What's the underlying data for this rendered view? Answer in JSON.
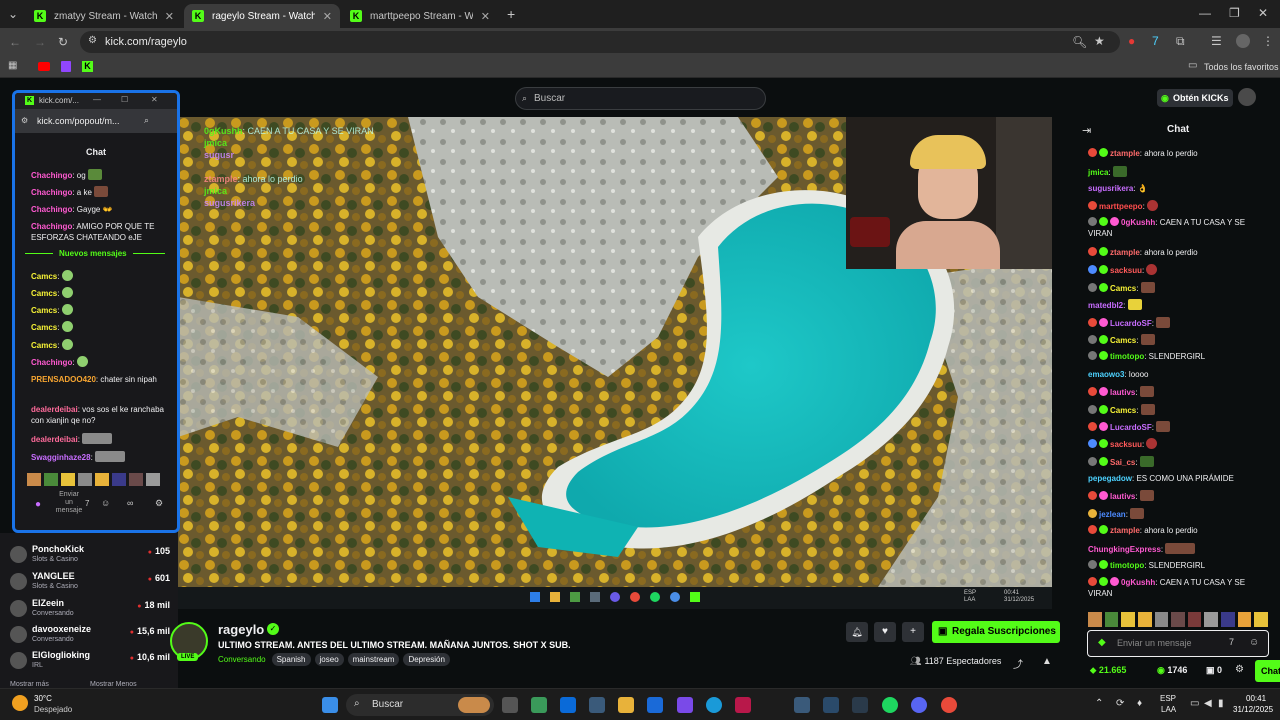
{
  "browser": {
    "tabs": [
      {
        "title": "zmatyy Stream - Watch Live o"
      },
      {
        "title": "rageylo Stream - Watch Liv"
      },
      {
        "title": "marttpeepo Stream - Watch Li"
      }
    ],
    "url": "kick.com/rageylo",
    "all_bookmarks": "Todos los favoritos"
  },
  "header": {
    "search_placeholder": "Buscar",
    "kicks_button": "Obtén KICKs"
  },
  "popup": {
    "window_title": "kick.com/...",
    "url": "kick.com/popout/m...",
    "heading": "Chat",
    "new_messages": "Nuevos mensajes",
    "input_placeholder": "Enviar un mensaje",
    "messages": [
      {
        "user": "Chachingo",
        "color": "#ff5ad1",
        "text": "og"
      },
      {
        "user": "Chachingo",
        "color": "#ff5ad1",
        "text": "a ke"
      },
      {
        "user": "Chachingo",
        "color": "#ff5ad1",
        "text": "Gayge"
      },
      {
        "user": "Chachingo",
        "color": "#ff5ad1",
        "text": "AMIGO POR QUE TE ESFORZAS CHATEANDO eJE"
      }
    ],
    "messages2": [
      {
        "user": "Camcs",
        "color": "#f6f236",
        "text": ""
      },
      {
        "user": "Camcs",
        "color": "#f6f236",
        "text": ""
      },
      {
        "user": "Camcs",
        "color": "#f6f236",
        "text": ""
      },
      {
        "user": "Camcs",
        "color": "#f6f236",
        "text": ""
      },
      {
        "user": "Camcs",
        "color": "#f6f236",
        "text": ""
      },
      {
        "user": "Chachingo",
        "color": "#ff5ad1",
        "text": ""
      },
      {
        "user": "PRENSADOO420",
        "color": "#f7a531",
        "text": "chater sin nipah"
      },
      {
        "user": "dealerdeibai",
        "color": "#ff6b9b",
        "text": "vos sos el ke ranchaba con xianjin qe no?"
      },
      {
        "user": "dealerdeibai",
        "color": "#ff6b9b",
        "text": ""
      },
      {
        "user": "Swagginhaze28",
        "color": "#c86dff",
        "text": ""
      }
    ]
  },
  "following": [
    {
      "name": "PonchoKick",
      "game": "Slots & Casino",
      "viewers": "105"
    },
    {
      "name": "YANGLEE",
      "game": "Slots & Casino",
      "viewers": "601"
    },
    {
      "name": "ElZeein",
      "game": "Conversando",
      "viewers": "18 mil"
    },
    {
      "name": "davooxeneize",
      "game": "Conversando",
      "viewers": "15,6 mil"
    },
    {
      "name": "ElGloglioking",
      "game": "IRL",
      "viewers": "10,6 mil"
    }
  ],
  "sidebar_footer": {
    "more": "Mostrar más",
    "less": "Mostrar Menos"
  },
  "stream": {
    "channel": "rageylo",
    "live_label": "LIVE",
    "title": "ULTIMO STREAM. ANTES DEL ULTIMO STREAM. MAÑANA JUNTOS. SHOT X SUB.",
    "category": "Conversando",
    "tags": [
      "Spanish",
      "joseo",
      "mainstream",
      "Depresión"
    ],
    "viewers": "1187 Espectadores",
    "gift_button": "Regala Suscripciones"
  },
  "chat": {
    "heading": "Chat",
    "input_placeholder": "Enviar un mensaje",
    "balance_green": "21.665",
    "balance_kicks": "1746",
    "gift_count": "0",
    "chat_button": "Chat",
    "messages": [
      {
        "user": "ztample",
        "color": "#ff6b6b",
        "text": "ahora lo perdio"
      },
      {
        "user": "jmica",
        "color": "#53fc18",
        "text": ""
      },
      {
        "user": "sugusrikera",
        "color": "#c86dff",
        "text": ""
      },
      {
        "user": "marttpeepo",
        "color": "#ff4d4d",
        "text": ""
      },
      {
        "user": "0gKushh",
        "color": "#ff5ad1",
        "text": "CAEN A TU CASA Y SE VIRAN"
      },
      {
        "user": "ztample",
        "color": "#ff6b6b",
        "text": "ahora lo perdio"
      },
      {
        "user": "sacksuu",
        "color": "#ff5a5a",
        "text": ""
      },
      {
        "user": "Camcs",
        "color": "#f6f236",
        "text": ""
      },
      {
        "user": "matedbl2",
        "color": "#c86dff",
        "text": ""
      },
      {
        "user": "LucardoSF",
        "color": "#c86dff",
        "text": ""
      },
      {
        "user": "Camcs",
        "color": "#f6f236",
        "text": ""
      },
      {
        "user": "timotopo",
        "color": "#53fc18",
        "text": "SLENDERGIRL"
      },
      {
        "user": "emaowo3",
        "color": "#4dd2ff",
        "text": "loooo"
      },
      {
        "user": "lautivs",
        "color": "#ff5ad1",
        "text": ""
      },
      {
        "user": "Camcs",
        "color": "#f6f236",
        "text": ""
      },
      {
        "user": "LucardoSF",
        "color": "#c86dff",
        "text": ""
      },
      {
        "user": "sacksuu",
        "color": "#ff5a5a",
        "text": ""
      },
      {
        "user": "Sai_cs",
        "color": "#ff6b6b",
        "text": ""
      },
      {
        "user": "pepegadow",
        "color": "#4dd2ff",
        "text": "ES COMO UNA PIRÁMIDE"
      },
      {
        "user": "lautivs",
        "color": "#ff5ad1",
        "text": ""
      },
      {
        "user": "jezlean",
        "color": "#4d8bff",
        "text": ""
      },
      {
        "user": "ztample",
        "color": "#ff6b6b",
        "text": "ahora lo perdio"
      },
      {
        "user": "ChungkingExpress",
        "color": "#ff5ad1",
        "text": ""
      },
      {
        "user": "timotopo",
        "color": "#53fc18",
        "text": "SLENDERGIRL"
      },
      {
        "user": "0gKushh",
        "color": "#ff5ad1",
        "text": "CAEN A TU CASA Y SE VIRAN"
      }
    ]
  },
  "overlay_chat": [
    {
      "user": "0gKushh",
      "text": "CAEN A TU CASA Y SE VIRAN"
    },
    {
      "user": "jmica",
      "text": ""
    },
    {
      "user": "sugusr",
      "text": ""
    },
    {
      "user": "ztample",
      "text": "ahora lo perdio"
    },
    {
      "user": "jmica",
      "text": ""
    },
    {
      "user": "sugusrikera",
      "text": ""
    }
  ],
  "windows": {
    "weather_temp": "30°C",
    "weather_desc": "Despejado",
    "search": "Buscar",
    "lang": "ESP",
    "lang2": "LAA",
    "time": "00:41",
    "date": "31/12/2025"
  }
}
